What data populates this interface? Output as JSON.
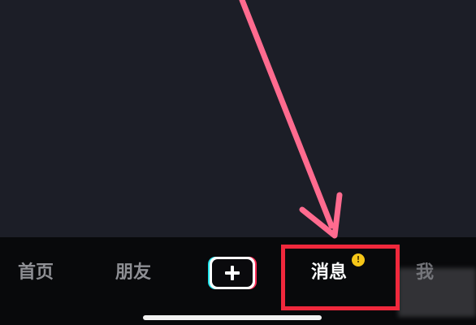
{
  "bottom_nav": {
    "home_label": "首页",
    "friends_label": "朋友",
    "create_icon": "plus-icon",
    "messages_label": "消息",
    "messages_badge": "!",
    "me_label": "我"
  },
  "annotations": {
    "arrow_color": "#ff6b8f",
    "highlight_color": "#f0283c"
  },
  "colors": {
    "background": "#1c1e27",
    "tab_bar": "#08090b",
    "active_tab_text": "#ffffff",
    "inactive_tab_text": "#8e8f94",
    "badge": "#f5c618",
    "create_cyan": "#24e5ec",
    "create_pink": "#fe2c55"
  }
}
